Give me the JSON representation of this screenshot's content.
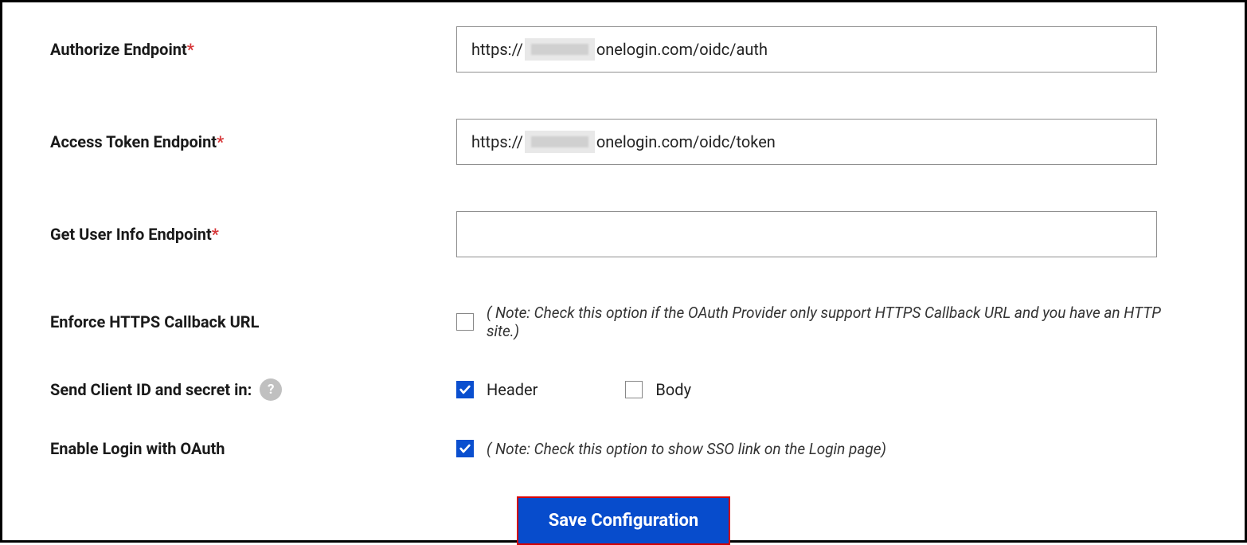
{
  "fields": {
    "authorize": {
      "label": "Authorize Endpoint",
      "required": "*",
      "prefix": "https://",
      "suffix": "onelogin.com/oidc/auth"
    },
    "token": {
      "label": "Access Token Endpoint",
      "required": "*",
      "prefix": "https://",
      "suffix": "onelogin.com/oidc/token"
    },
    "userinfo": {
      "label": "Get User Info Endpoint",
      "required": "*",
      "value": ""
    },
    "enforce_https": {
      "label": "Enforce HTTPS Callback URL",
      "checked": false,
      "note": "( Note: Check this option if the OAuth Provider only support HTTPS Callback URL and you have an HTTP site.)"
    },
    "send_in": {
      "label": "Send Client ID and secret in:",
      "help": "?",
      "options": {
        "header": {
          "label": "Header",
          "checked": true
        },
        "body": {
          "label": "Body",
          "checked": false
        }
      }
    },
    "enable_oauth": {
      "label": "Enable Login with OAuth",
      "checked": true,
      "note": "( Note: Check this option to show SSO link on the Login page)"
    }
  },
  "buttons": {
    "save": "Save Configuration"
  }
}
